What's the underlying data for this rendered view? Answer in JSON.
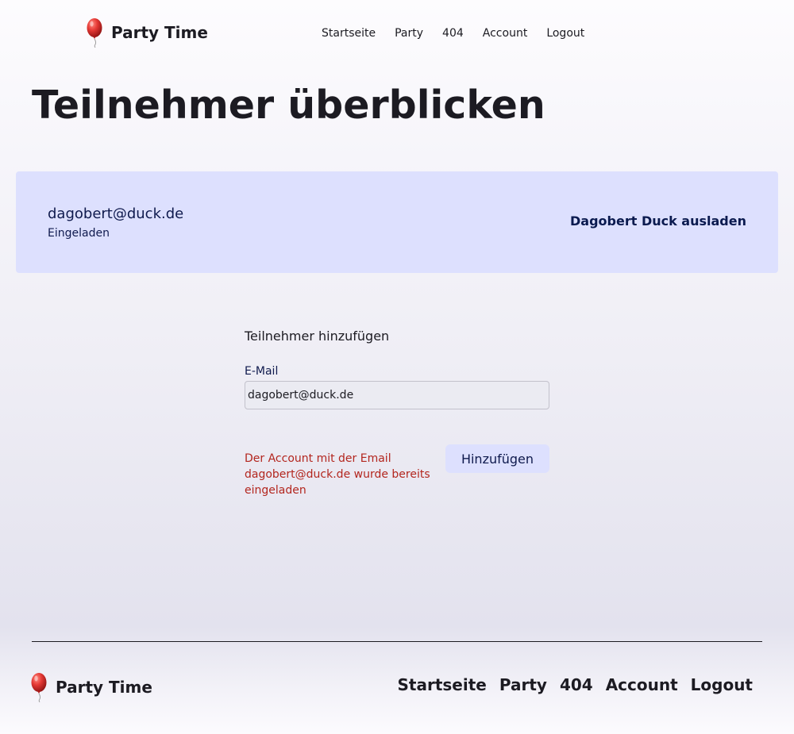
{
  "app": {
    "brand_name": "Party Time",
    "logo_icon": "balloon-icon",
    "accent_color": "#dde0fe",
    "error_color": "#b3261e"
  },
  "header": {
    "nav": [
      {
        "label": "Startseite"
      },
      {
        "label": "Party"
      },
      {
        "label": "404"
      },
      {
        "label": "Account"
      },
      {
        "label": "Logout"
      }
    ]
  },
  "page": {
    "title": "Teilnehmer überblicken"
  },
  "participants": [
    {
      "email": "dagobert@duck.de",
      "status": "Eingeladen",
      "action_label": "Dagobert Duck ausladen"
    }
  ],
  "add_form": {
    "heading": "Teilnehmer hinzufügen",
    "email_label": "E-Mail",
    "email_value": "dagobert@duck.de",
    "error": "Der Account mit der Email dagobert@duck.de wurde bereits eingeladen",
    "submit_label": "Hinzufügen"
  },
  "footer": {
    "nav": [
      {
        "label": "Startseite"
      },
      {
        "label": "Party"
      },
      {
        "label": "404"
      },
      {
        "label": "Account"
      },
      {
        "label": "Logout"
      }
    ]
  }
}
